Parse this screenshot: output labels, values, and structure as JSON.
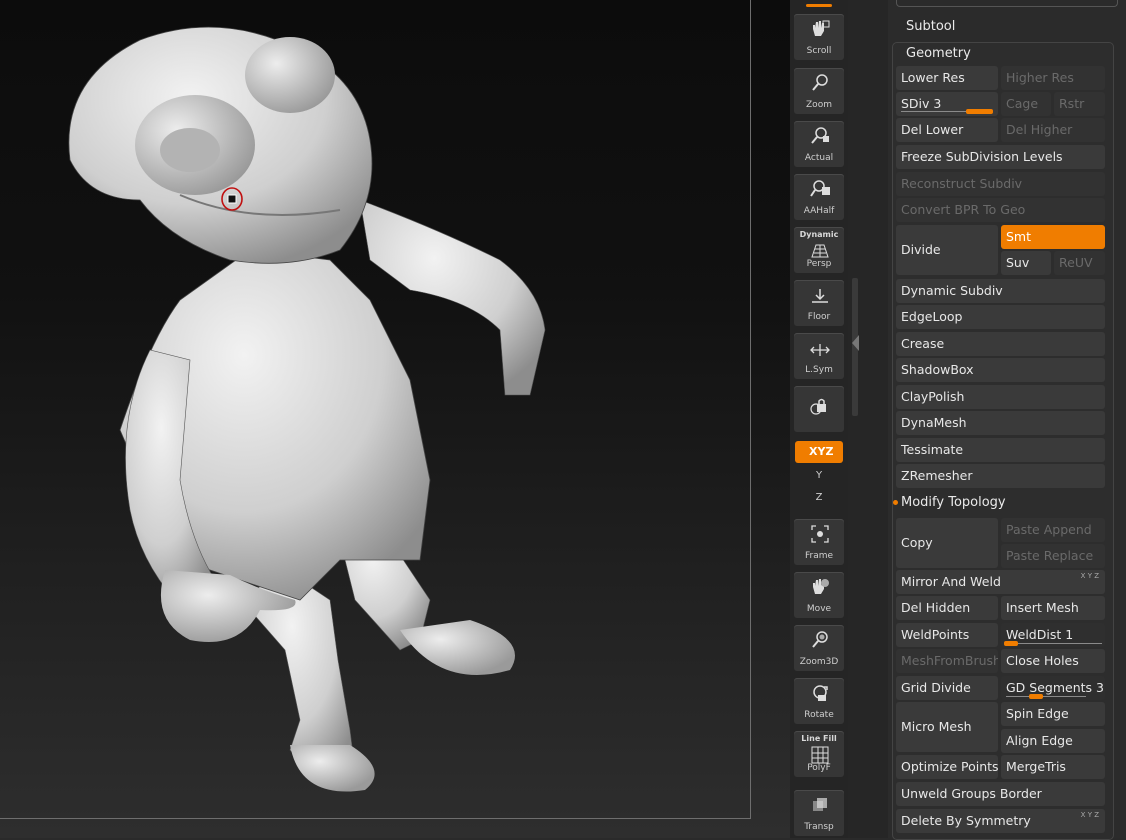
{
  "toolbar": {
    "scroll": "Scroll",
    "zoom": "Zoom",
    "actual": "Actual",
    "aahalf": "AAHalf",
    "persp_top": "Dynamic",
    "persp": "Persp",
    "floor": "Floor",
    "lsym": "L.Sym",
    "xyz": "XYZ",
    "frame": "Frame",
    "move": "Move",
    "zoom3d": "Zoom3D",
    "rotate": "Rotate",
    "polyf_top": "Line Fill",
    "polyf": "PolyF",
    "transp": "Transp",
    "axis_y": "Y",
    "axis_z": "Z"
  },
  "panel": {
    "subtool": "Subtool",
    "geometry": "Geometry",
    "lower_res": "Lower Res",
    "higher_res": "Higher Res",
    "sdiv_label": "SDiv 3",
    "sdiv_value": 3,
    "sdiv_max": 3,
    "cage": "Cage",
    "rstr": "Rstr",
    "del_lower": "Del Lower",
    "del_higher": "Del Higher",
    "freeze": "Freeze SubDivision Levels",
    "reconstruct": "Reconstruct Subdiv",
    "convert_bpr": "Convert BPR To Geo",
    "divide": "Divide",
    "smt": "Smt",
    "suv": "Suv",
    "reuv": "ReUV",
    "dynamic_subdiv": "Dynamic Subdiv",
    "edgeloop": "EdgeLoop",
    "crease": "Crease",
    "shadowbox": "ShadowBox",
    "claypolish": "ClayPolish",
    "dynamesh": "DynaMesh",
    "tessimate": "Tessimate",
    "zremesher": "ZRemesher",
    "modify_topology": "Modify Topology",
    "copy": "Copy",
    "paste_append": "Paste Append",
    "paste_replace": "Paste Replace",
    "mirror_weld": "Mirror And Weld",
    "del_hidden": "Del Hidden",
    "insert_mesh": "Insert Mesh",
    "weldpoints": "WeldPoints",
    "welddist": "WeldDist 1",
    "meshfrombrush": "MeshFromBrush",
    "close_holes": "Close Holes",
    "grid_divide": "Grid Divide",
    "gd_segments": "GD Segments 3",
    "micro_mesh": "Micro Mesh",
    "spin_edge": "Spin Edge",
    "align_edge": "Align Edge",
    "optimize_points": "Optimize Points",
    "mergetris": "MergeTris",
    "unweld_groups": "Unweld Groups Border",
    "delete_symmetry": "Delete By Symmetry",
    "xyz_mini": "X Y Z"
  },
  "colors": {
    "accent": "#f07d00",
    "panel_bg": "#2b2b2b",
    "button_bg": "#3a3a3a"
  }
}
